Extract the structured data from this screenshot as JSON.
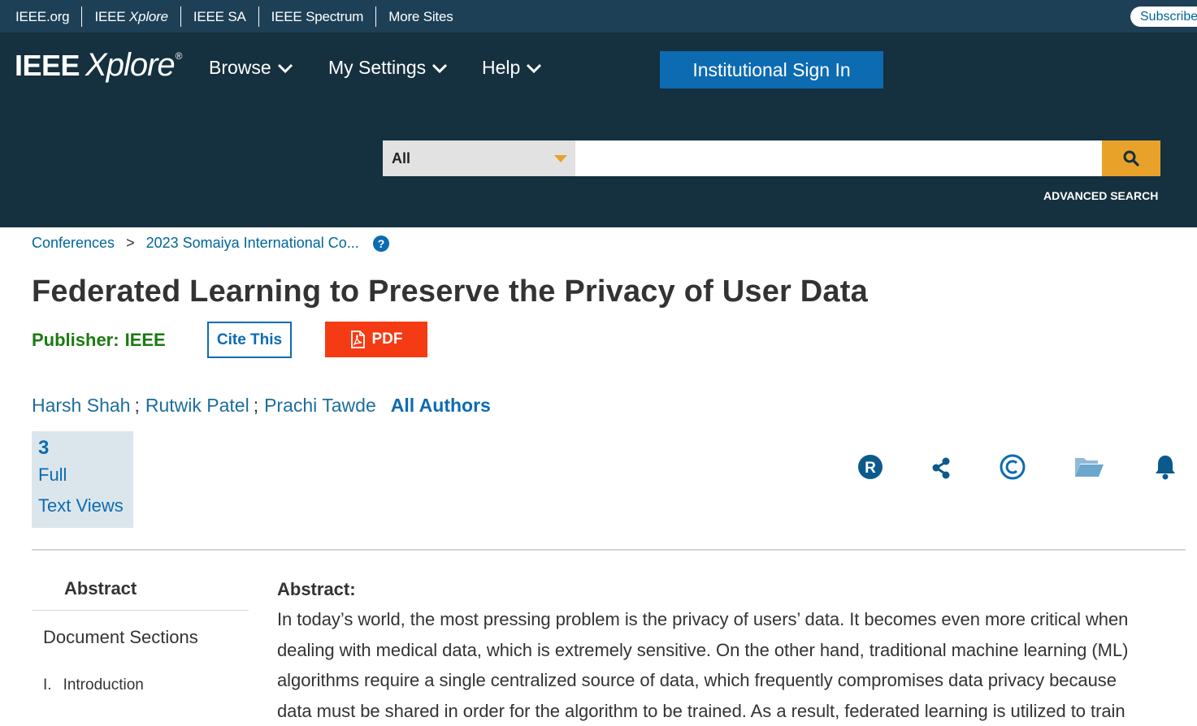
{
  "topbar": {
    "links": [
      "IEEE.org",
      "IEEE Xplore",
      "IEEE SA",
      "IEEE Spectrum",
      "More Sites"
    ],
    "subscribe": "Subscribe"
  },
  "header": {
    "logo_ieee": "IEEE",
    "logo_xplore": "Xplore",
    "logo_reg": "®",
    "nav": {
      "browse": "Browse",
      "my_settings": "My Settings",
      "help": "Help"
    },
    "signin": "Institutional Sign In",
    "search": {
      "scope": "All",
      "placeholder": "",
      "icon": "search-icon"
    },
    "advanced_search": "ADVANCED SEARCH",
    "colors": {
      "topbar": "#1d4056",
      "header": "#15303f",
      "accent": "#e8a22a",
      "signin": "#0c6bb1"
    }
  },
  "breadcrumb": {
    "root": "Conferences",
    "sep": ">",
    "current": "2023 Somaiya International Co..."
  },
  "document": {
    "title": "Federated Learning to Preserve the Privacy of User Data",
    "publisher_label": "Publisher:",
    "publisher": "IEEE",
    "cite_label": "Cite This",
    "pdf_label": "PDF",
    "authors": [
      "Harsh Shah",
      "Rutwik Patel",
      "Prachi Tawde"
    ],
    "author_sep": ";",
    "all_authors": "All Authors",
    "metric": {
      "value": "3",
      "label_1": "Full",
      "label_2": "Text Views"
    },
    "action_icons": [
      "rights-icon",
      "share-icon",
      "copyright-icon",
      "folder-icon",
      "alert-bell-icon"
    ]
  },
  "sidebar": {
    "abstract": "Abstract",
    "document_sections": "Document Sections",
    "sections": [
      {
        "num": "I.",
        "label": "Introduction"
      }
    ]
  },
  "abstract": {
    "heading": "Abstract:",
    "lines": [
      "In today’s world, the most pressing problem is the privacy of users’ data. It becomes even more critical when",
      "dealing with medical data, which is extremely sensitive. On the other hand, traditional machine learning (ML)",
      "algorithms require a single centralized source of data, which frequently compromises data privacy because",
      "data must be shared in order for the algorithm to be trained. As a result, federated learning is utilized to train"
    ]
  }
}
